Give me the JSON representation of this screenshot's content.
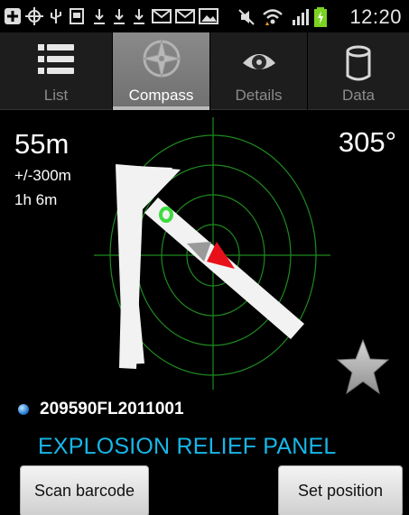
{
  "status_bar": {
    "time": "12:20",
    "icons": [
      "add-icon",
      "gps-icon",
      "usb-icon",
      "sd-card-icon",
      "download-icon",
      "download-icon",
      "download-icon",
      "email-icon",
      "email-icon",
      "image-icon",
      "mute-icon",
      "wifi-icon",
      "signal-icon",
      "battery-charging-icon"
    ]
  },
  "tabs": [
    {
      "label": "List",
      "icon": "list-icon",
      "active": false
    },
    {
      "label": "Compass",
      "icon": "compass-icon",
      "active": true
    },
    {
      "label": "Details",
      "icon": "eye-icon",
      "active": false
    },
    {
      "label": "Data",
      "icon": "database-icon",
      "active": false
    }
  ],
  "compass": {
    "distance": "55m",
    "accuracy": "+/-300m",
    "eta": "1h 6m",
    "bearing": "305°"
  },
  "waypoint": {
    "code": "209590FL2011001",
    "name": "EXPLOSION RELIEF PANEL"
  },
  "buttons": {
    "scan": "Scan barcode",
    "set_position": "Set position"
  },
  "colors": {
    "radar": "#1f8a1f",
    "accent_text": "#16b7e8",
    "heading_marker": "#e8101a",
    "target_dot": "#3ddc3d"
  }
}
